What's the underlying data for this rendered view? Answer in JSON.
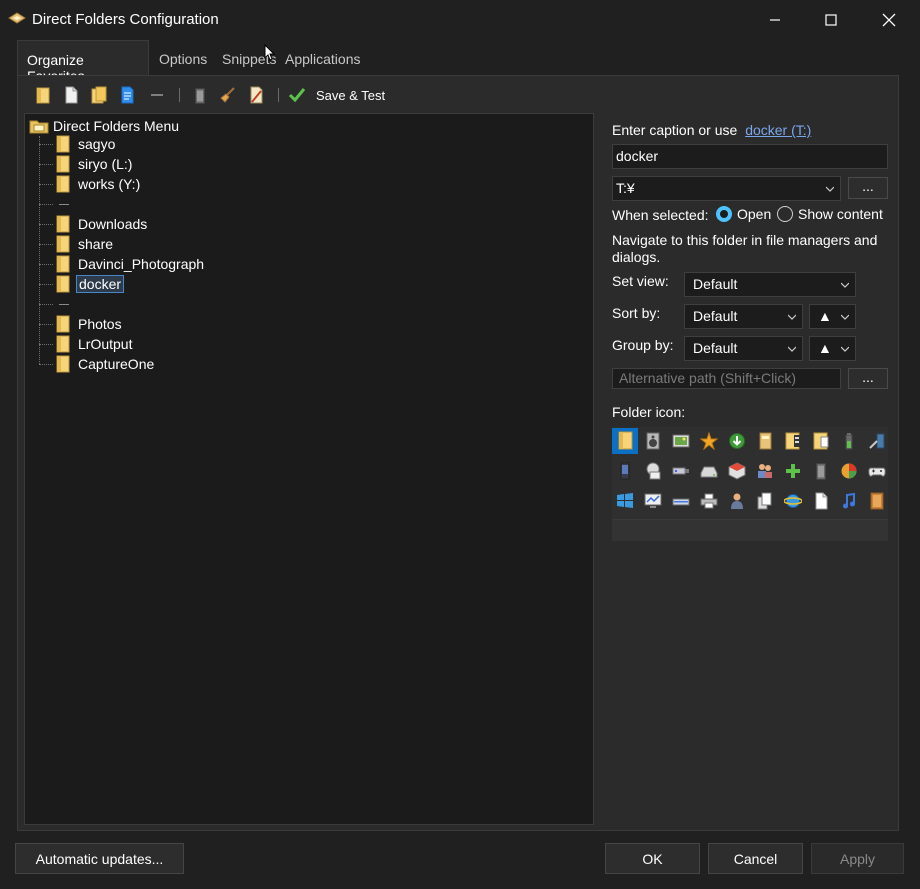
{
  "window": {
    "title": "Direct Folders Configuration"
  },
  "tabs": [
    {
      "label": "Organize Favorites",
      "active": true
    },
    {
      "label": "Options"
    },
    {
      "label": "Snippets"
    },
    {
      "label": "Applications"
    }
  ],
  "toolbar": {
    "save_test_label": "Save & Test"
  },
  "tree": {
    "root_label": "Direct Folders Menu",
    "items": [
      {
        "type": "folder",
        "label": "sagyo"
      },
      {
        "type": "folder",
        "label": "siryo (L:)"
      },
      {
        "type": "folder",
        "label": "works (Y:)"
      },
      {
        "type": "separator",
        "label": ""
      },
      {
        "type": "folder",
        "label": "Downloads"
      },
      {
        "type": "folder",
        "label": "share"
      },
      {
        "type": "folder",
        "label": "Davinci_Photograph"
      },
      {
        "type": "folder",
        "label": "docker",
        "selected": true
      },
      {
        "type": "separator",
        "label": ""
      },
      {
        "type": "folder",
        "label": "Photos"
      },
      {
        "type": "folder",
        "label": "LrOutput"
      },
      {
        "type": "folder",
        "label": "CaptureOne"
      }
    ]
  },
  "props": {
    "caption_prompt": "Enter caption or use",
    "caption_link": "docker (T:)",
    "caption_value": "docker",
    "path_value": "T:¥",
    "browse_label": "...",
    "when_selected_label": "When selected:",
    "radio_open": "Open",
    "radio_show_content": "Show content",
    "navigate_desc": "Navigate to this folder in file managers and dialogs.",
    "set_view_label": "Set view:",
    "set_view_value": "Default",
    "sort_by_label": "Sort by:",
    "sort_by_value": "Default",
    "sort_dir": "▲",
    "group_by_label": "Group by:",
    "group_by_value": "Default",
    "group_dir": "▲",
    "alt_path_placeholder": "Alternative path (Shift+Click)",
    "alt_browse_label": "...",
    "folder_icon_label": "Folder icon:"
  },
  "buttons": {
    "auto_updates": "Automatic updates...",
    "ok": "OK",
    "cancel": "Cancel",
    "apply": "Apply"
  },
  "colors": {
    "accent": "#4cc2ff",
    "folder": "#f6d57a",
    "selected_icon_bg": "#0b6fc4",
    "link": "#7aa7ee"
  }
}
